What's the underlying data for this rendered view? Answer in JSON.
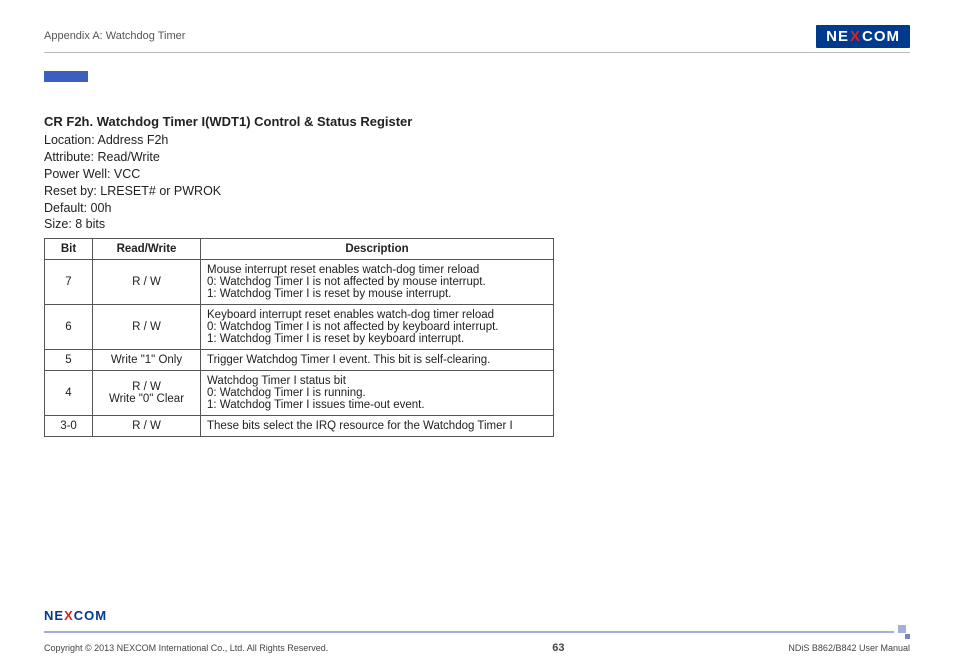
{
  "header": {
    "appendix": "Appendix A: Watchdog Timer",
    "brand_pre": "NE",
    "brand_x": "X",
    "brand_post": "COM"
  },
  "section": {
    "title": "CR F2h. Watchdog Timer I(WDT1) Control & Status Register",
    "location": "Location: Address F2h",
    "attribute": "Attribute: Read/Write",
    "power_well": "Power Well: VCC",
    "reset_by": "Reset by: LRESET# or PWROK",
    "default": "Default: 00h",
    "size": "Size: 8 bits"
  },
  "table": {
    "headers": {
      "bit": "Bit",
      "rw": "Read/Write",
      "desc": "Description"
    },
    "rows": [
      {
        "bit": "7",
        "rw": "R / W",
        "desc_l1": "Mouse interrupt reset enables watch-dog timer reload",
        "desc_l2": "0: Watchdog Timer I is not affected by mouse interrupt.",
        "desc_l3": "1: Watchdog Timer I is reset by mouse interrupt."
      },
      {
        "bit": "6",
        "rw": "R / W",
        "desc_l1": "Keyboard interrupt reset enables watch-dog timer reload",
        "desc_l2": "0: Watchdog Timer I is not affected by keyboard interrupt.",
        "desc_l3": "1: Watchdog Timer I is reset by keyboard interrupt."
      },
      {
        "bit": "5",
        "rw": "Write \"1\" Only",
        "desc_l1": "Trigger Watchdog Timer I event. This bit is self-clearing."
      },
      {
        "bit": "4",
        "rw_l1": "R / W",
        "rw_l2": "Write \"0\" Clear",
        "desc_l1": "Watchdog Timer I status bit",
        "desc_l2": "0: Watchdog Timer I is running.",
        "desc_l3": "1: Watchdog Timer I issues time-out event."
      },
      {
        "bit": "3-0",
        "rw": "R / W",
        "desc_l1": "These bits select the IRQ resource for the Watchdog Timer I"
      }
    ]
  },
  "footer": {
    "copyright": "Copyright © 2013 NEXCOM International Co., Ltd. All Rights Reserved.",
    "page": "63",
    "manual": "NDiS B862/B842 User Manual"
  }
}
